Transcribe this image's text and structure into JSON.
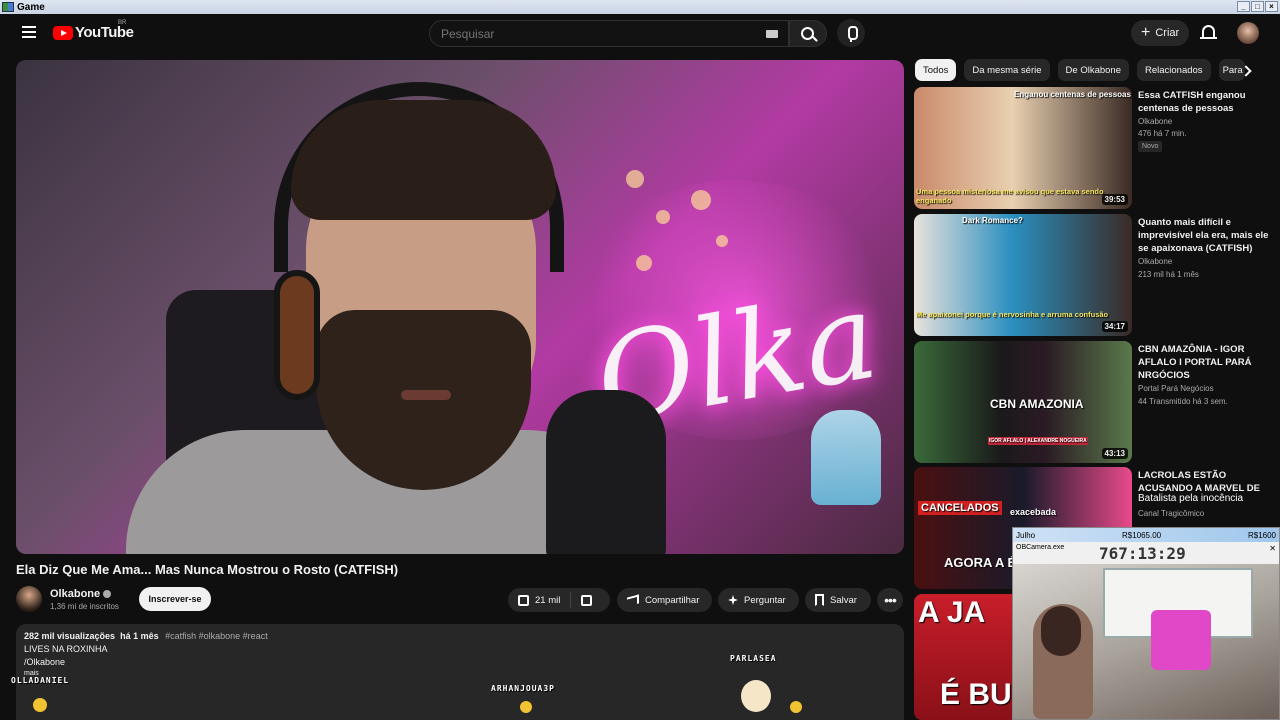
{
  "window": {
    "title": "Game"
  },
  "header": {
    "logo_text": "YouTube",
    "region": "BR",
    "search_placeholder": "Pesquisar",
    "create_label": "Criar"
  },
  "video": {
    "title": "Ela Diz Que Me Ama... Mas Nunca Mostrou o Rosto (CATFISH)",
    "neon_sign": "Olka",
    "channel": "Olkabone",
    "subscribers": "1,36 mi de inscritos",
    "subscribe_label": "Inscrever-se",
    "likes": "21 mil",
    "share_label": "Compartilhar",
    "ask_label": "Perguntar",
    "save_label": "Salvar",
    "views": "282 mil visualizações",
    "age": "há 1 mês",
    "tags": "#catfish #olkabone #react",
    "desc_line1": "LIVES NA ROXINHA",
    "desc_line2": "/Olkabone",
    "desc_more": "mais"
  },
  "overlay": {
    "user1": "OLLADANIEL",
    "user2": "ARHANJOUA3P",
    "user3": "PARLASEA"
  },
  "chips": [
    "Todos",
    "Da mesma série",
    "De Olkabone",
    "Relacionados",
    "Para"
  ],
  "recommendations": [
    {
      "title": "Essa CATFISH enganou centenas de pessoas",
      "channel": "Olkabone",
      "meta": "476   há 7 min.",
      "badge": "Novo",
      "duration": "39:53",
      "caption_top": "Enganou centenas de pessoas",
      "caption_bottom": "Uma pessoa misteriosa me avisou que estava sendo enganado"
    },
    {
      "title": "Quanto mais difícil e imprevisível ela era, mais ele se apaixonava (CATFISH)",
      "channel": "Olkabone",
      "meta": "213 mil   há 1 mês",
      "duration": "34:17",
      "caption_top": "Dark Romance?",
      "caption_bottom": "Me apaixonei porque é nervosinha e arruma confusão"
    },
    {
      "title": "CBN AMAZÔNIA - IGOR AFLALO I PORTAL PARÁ NRGÓCIOS",
      "channel": "Portal Pará Negócios",
      "meta": "44   Transmitido há 3 sem.",
      "duration": "43:13",
      "caption_top": "CBN AMAZONIA",
      "caption_bottom": "IGOR AFLALO | ALEXANDRE NOGUEIRA"
    },
    {
      "title": "LACROLAS ESTÃO ACUSANDO A MARVEL DE",
      "channel": "Canal Tragicômico",
      "overlay": "Batalista pela inocência",
      "caption_top": "CANCELADOS",
      "caption_mid": "exacebada",
      "caption_bottom": "AGORA A  É R@CIST"
    },
    {
      "caption_top": "A JA",
      "caption_bottom": "É BU"
    }
  ],
  "camera": {
    "name": "Julho",
    "value1": "R$1065.00",
    "value2": "R$1600",
    "app": "OBCamera.exe",
    "timer": "767:13:29"
  },
  "colors": {
    "accent": "#ff0000",
    "bg": "#0f0f0f",
    "surface": "#272727"
  }
}
